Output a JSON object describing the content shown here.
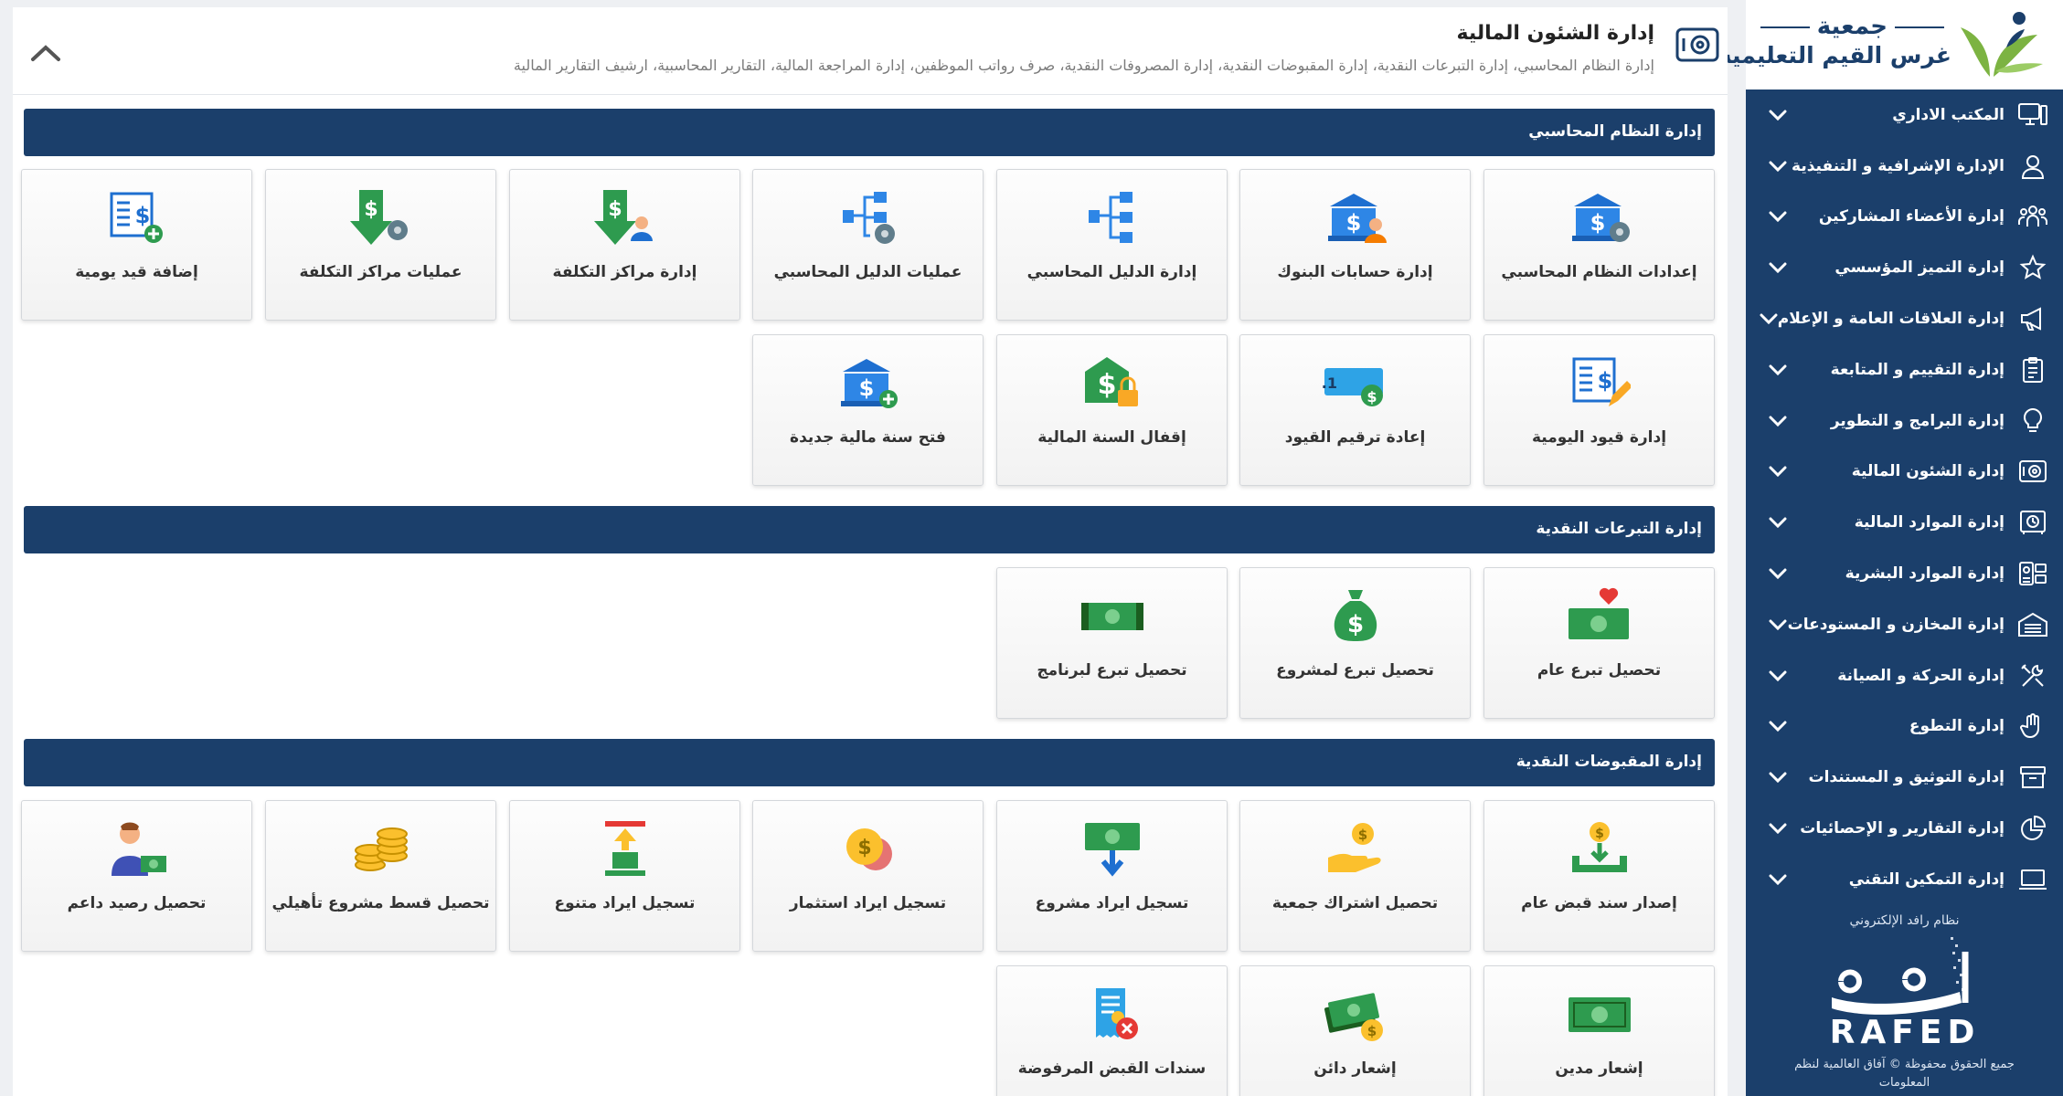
{
  "brand": {
    "top": "جمعية",
    "bottom": "غرس القيم التعليمية",
    "colors": {
      "primary": "#1b3f6b",
      "logo_green": "#7cb342"
    }
  },
  "sidebar": {
    "items": [
      {
        "label": "المكتب الاداري",
        "icon": "monitor-icon"
      },
      {
        "label": "الإدارة الإشرافية و التنفيذية",
        "icon": "user-icon"
      },
      {
        "label": "إدارة الأعضاء المشاركين",
        "icon": "group-icon"
      },
      {
        "label": "إدارة التميز المؤسسي",
        "icon": "star-icon"
      },
      {
        "label": "إدارة العلاقات العامة و الإعلام",
        "icon": "megaphone-icon"
      },
      {
        "label": "إدارة التقييم و المتابعة",
        "icon": "clipboard-icon"
      },
      {
        "label": "إدارة البرامج و التطوير",
        "icon": "lightbulb-icon"
      },
      {
        "label": "إدارة الشئون المالية",
        "icon": "safe-icon"
      },
      {
        "label": "إدارة الموارد المالية",
        "icon": "vault-icon"
      },
      {
        "label": "إدارة الموارد البشرية",
        "icon": "id-card-icon"
      },
      {
        "label": "إدارة المخازن و المستودعات",
        "icon": "warehouse-icon"
      },
      {
        "label": "إدارة الحركة و الصيانة",
        "icon": "tools-icon"
      },
      {
        "label": "إدارة التطوع",
        "icon": "hand-icon"
      },
      {
        "label": "إدارة التوثيق و المستندات",
        "icon": "archive-icon"
      },
      {
        "label": "إدارة التقارير و الإحصائيات",
        "icon": "pie-chart-icon"
      },
      {
        "label": "إدارة التمكين التقني",
        "icon": "laptop-icon"
      }
    ],
    "footer": {
      "system_label": "نظام رافد الإلكتروني",
      "logo_text": "RAFED",
      "copyright": "جميع الحقوق محفوظة © آفاق العالمية لنظم المعلومات"
    }
  },
  "page": {
    "title": "إدارة الشئون المالية",
    "subtitle": "إدارة النظام المحاسبي، إدارة التبرعات النقدية، إدارة المقبوضات النقدية، إدارة المصروفات النقدية، صرف رواتب الموظفين، إدارة المراجعة المالية، التقارير المحاسبية، ارشيف التقارير المالية"
  },
  "sections": {
    "accounting": {
      "title": "إدارة النظام المحاسبي",
      "cards": [
        "إعدادات النظام المحاسبي",
        "إدارة حسابات البنوك",
        "إدارة الدليل المحاسبي",
        "عمليات الدليل المحاسبي",
        "إدارة مراكز التكلفة",
        "عمليات مراكز التكلفة",
        "إضافة قيد يومية",
        "إدارة قيود اليومية",
        "إعادة ترقيم القيود",
        "إقفال السنة المالية",
        "فتح سنة مالية جديدة"
      ]
    },
    "donations": {
      "title": "إدارة التبرعات النقدية",
      "cards": [
        "تحصيل تبرع عام",
        "تحصيل تبرع لمشروع",
        "تحصيل تبرع لبرنامج"
      ]
    },
    "receipts": {
      "title": "إدارة المقبوضات النقدية",
      "cards": [
        "إصدار سند قبض عام",
        "تحصيل اشتراك جمعية",
        "تسجيل ايراد مشروع",
        "تسجيل ايراد استثمار",
        "تسجيل ايراد متنوع",
        "تحصيل قسط مشروع تأهيلي",
        "تحصيل رصيد داعم",
        "إشعار مدين",
        "إشعار دائن",
        "سندات القبض المرفوضة"
      ]
    }
  }
}
